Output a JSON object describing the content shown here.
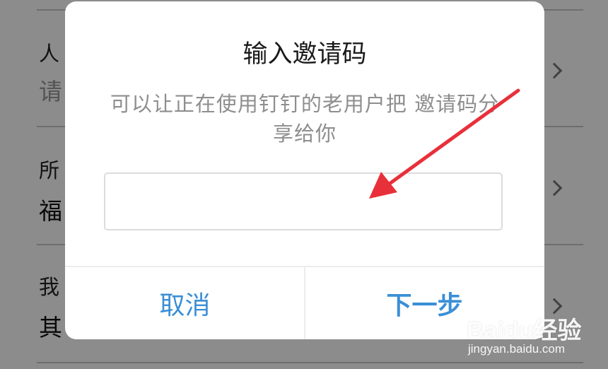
{
  "background_list": {
    "rows": [
      {
        "label": "人",
        "value": "请",
        "value_placeholder": true
      },
      {
        "label": "所",
        "value": "福",
        "value_placeholder": false
      },
      {
        "label": "我",
        "value": "其",
        "value_placeholder": false
      }
    ]
  },
  "dialog": {
    "title": "输入邀请码",
    "message": "可以让正在使用钉钉的老用户把 邀请码分享给你",
    "input": {
      "value": "",
      "placeholder": ""
    },
    "cancel_label": "取消",
    "next_label": "下一步"
  },
  "watermark": {
    "logo": "Baidu经验",
    "url": "jingyan.baidu.com"
  },
  "colors": {
    "accent": "#3b8fd6",
    "arrow": "#e8303a",
    "overlay": "rgba(0,0,0,0.45)"
  }
}
